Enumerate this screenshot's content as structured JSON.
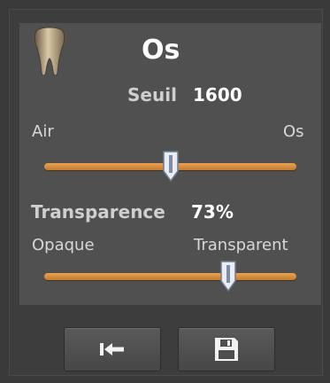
{
  "header": {
    "icon": "tooth-icon",
    "title": "Os"
  },
  "threshold": {
    "label": "Seuil",
    "value": "1600",
    "min_label": "Air",
    "max_label": "Os",
    "slider_fraction": 0.5
  },
  "transparency": {
    "label": "Transparence",
    "value": "73%",
    "min_label": "Opaque",
    "max_label": "Transparent",
    "slider_fraction": 0.73
  },
  "footer": {
    "reset_icon": "back-to-start-icon",
    "save_icon": "floppy-disk-icon"
  },
  "colors": {
    "accent": "#d98c3a",
    "background": "#3a3a3a",
    "panel": "#505050"
  }
}
